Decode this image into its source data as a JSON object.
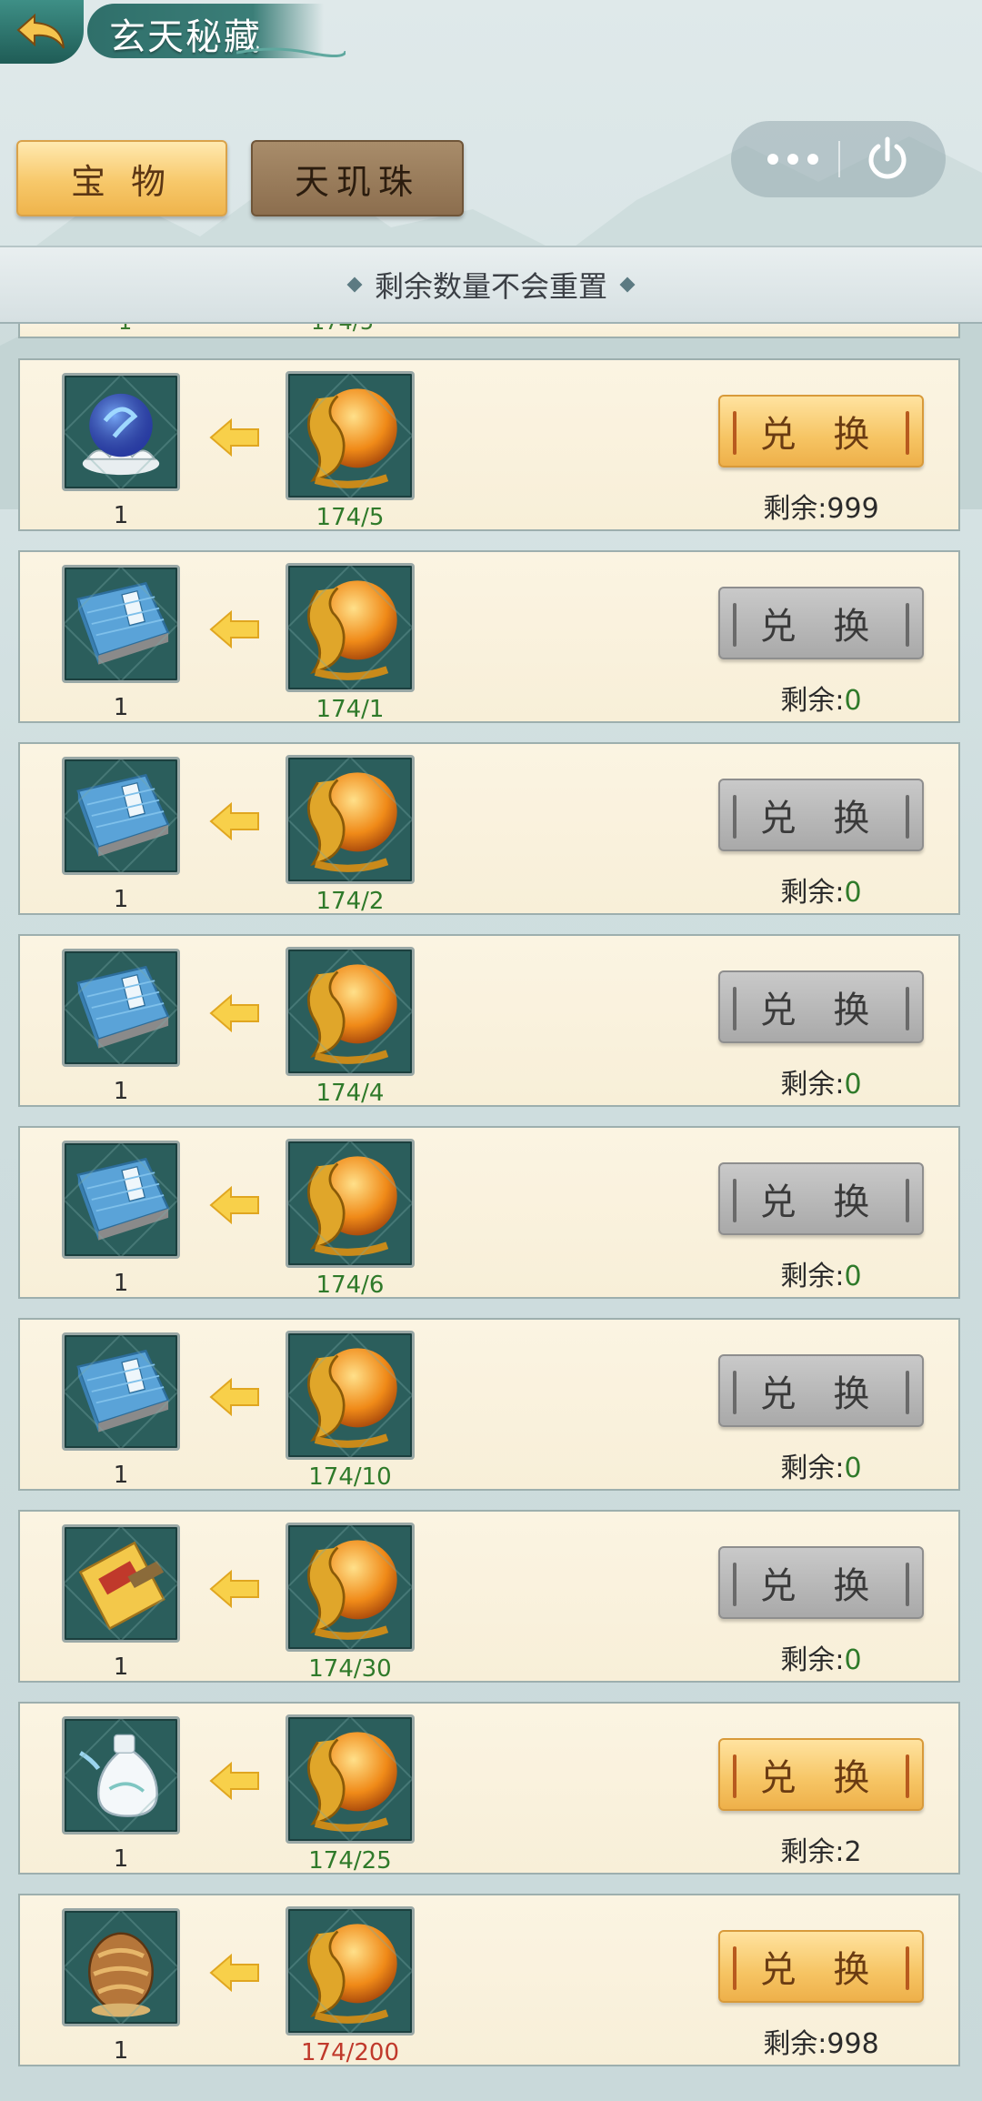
{
  "header": {
    "title": "玄天秘藏"
  },
  "tabs": [
    {
      "label": "宝 物",
      "active": true
    },
    {
      "label": "天玑珠",
      "active": false
    }
  ],
  "notice": "剩余数量不会重置",
  "partial_row": {
    "qty": "1",
    "cost": "174/5"
  },
  "rows": [
    {
      "item_icon": "blue-orb-lotus-icon",
      "qty": "1",
      "cost": "174/5",
      "cost_status": "ok",
      "button": "兑 换",
      "enabled": true,
      "remain_label": "剩余:",
      "remain_value": "999"
    },
    {
      "item_icon": "blue-book-icon",
      "qty": "1",
      "cost": "174/1",
      "cost_status": "ok",
      "button": "兑 换",
      "enabled": false,
      "remain_label": "剩余:",
      "remain_value": "0"
    },
    {
      "item_icon": "blue-book-icon",
      "qty": "1",
      "cost": "174/2",
      "cost_status": "ok",
      "button": "兑 换",
      "enabled": false,
      "remain_label": "剩余:",
      "remain_value": "0"
    },
    {
      "item_icon": "blue-book-icon",
      "qty": "1",
      "cost": "174/4",
      "cost_status": "ok",
      "button": "兑 换",
      "enabled": false,
      "remain_label": "剩余:",
      "remain_value": "0"
    },
    {
      "item_icon": "blue-book-icon",
      "qty": "1",
      "cost": "174/6",
      "cost_status": "ok",
      "button": "兑 换",
      "enabled": false,
      "remain_label": "剩余:",
      "remain_value": "0"
    },
    {
      "item_icon": "blue-book-icon",
      "qty": "1",
      "cost": "174/10",
      "cost_status": "ok",
      "button": "兑 换",
      "enabled": false,
      "remain_label": "剩余:",
      "remain_value": "0"
    },
    {
      "item_icon": "yellow-letter-icon",
      "qty": "1",
      "cost": "174/30",
      "cost_status": "ok",
      "button": "兑 换",
      "enabled": false,
      "remain_label": "剩余:",
      "remain_value": "0"
    },
    {
      "item_icon": "white-vase-icon",
      "qty": "1",
      "cost": "174/25",
      "cost_status": "ok",
      "button": "兑 换",
      "enabled": true,
      "remain_label": "剩余:",
      "remain_value": "2"
    },
    {
      "item_icon": "dragon-egg-icon",
      "qty": "1",
      "cost": "174/200",
      "cost_status": "low",
      "button": "兑 换",
      "enabled": true,
      "remain_label": "剩余:",
      "remain_value": "998"
    }
  ],
  "currency_icon": "golden-dragon-pearl-icon",
  "colors": {
    "accent_gold": "#f6c463",
    "ok_green": "#2f7a2a",
    "low_red": "#c0392b",
    "panel": "#fbf4e2"
  }
}
